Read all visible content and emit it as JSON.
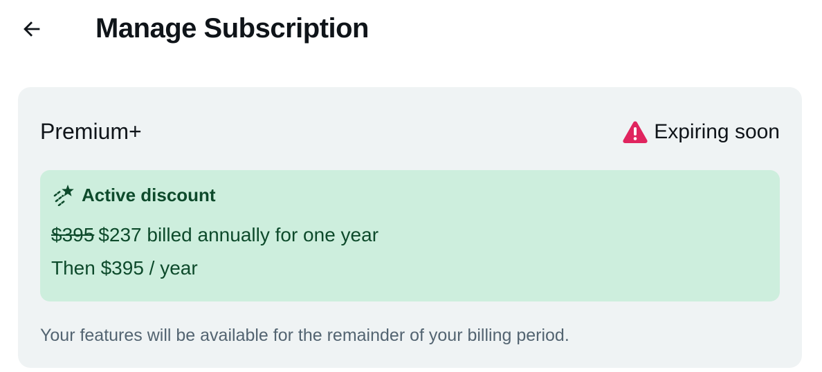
{
  "header": {
    "back_icon": "arrow-left-icon",
    "title": "Manage Subscription"
  },
  "subscription": {
    "plan_name": "Premium+",
    "status": {
      "icon": "warning-triangle-icon",
      "text": "Expiring soon",
      "icon_color": "#e0245e"
    },
    "discount": {
      "icon": "sparkle-stars-icon",
      "title": "Active discount",
      "old_price": "$395",
      "new_price_text": "$237 billed annually for one year",
      "then_text": "Then $395 / year",
      "background_color": "#cdeedd",
      "text_color": "#0d4a2b"
    },
    "footnote": "Your features will be available for the remainder of your billing period."
  }
}
